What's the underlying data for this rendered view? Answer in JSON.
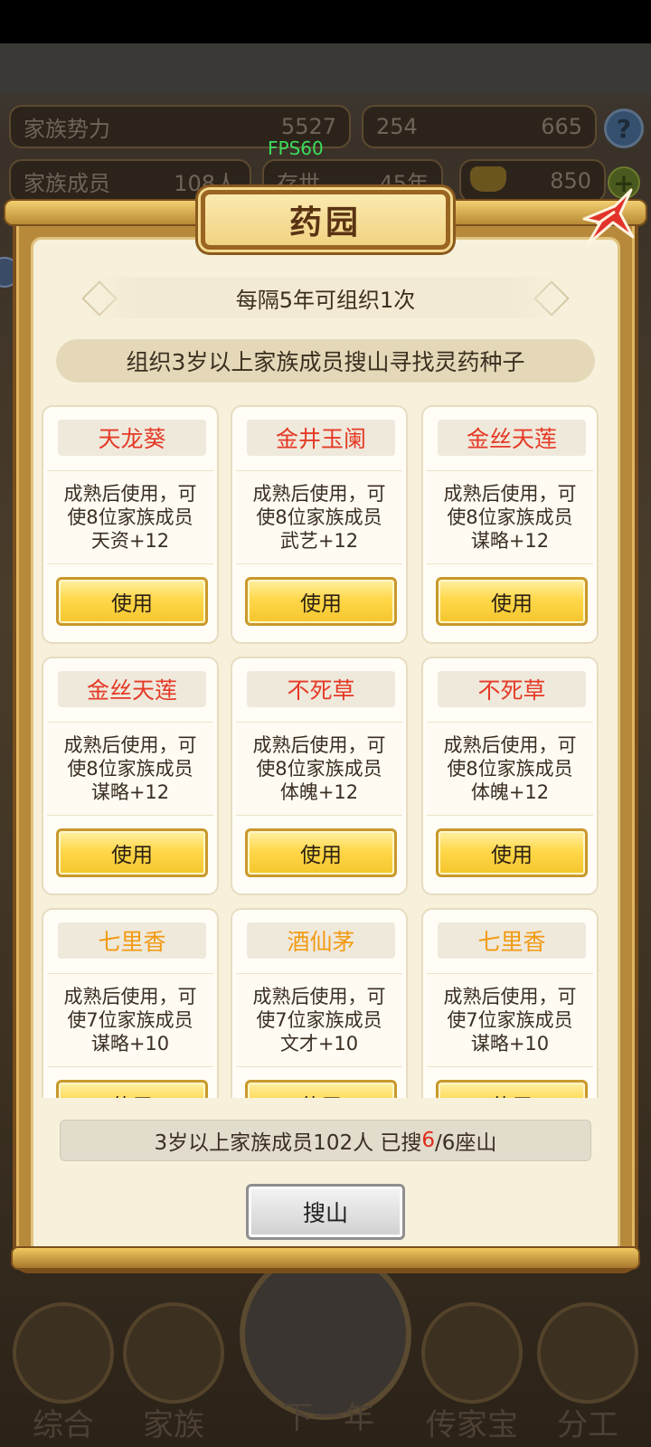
{
  "top_stats": {
    "power_label": "家族势力",
    "power_value": "5527",
    "members_label": "家族成员",
    "members_value": "108人",
    "alive_label": "存世",
    "alive_value": "45年",
    "res1_value": "254",
    "res2_value": "665",
    "gold_value": "850",
    "fps": "FPS60"
  },
  "dialog": {
    "title": "药园",
    "interval_text": "每隔5年可组织1次",
    "description": "组织3岁以上家族成员搜山寻找灵药种子",
    "cards": [
      {
        "name": "天龙葵",
        "line1": "成熟后使用，可",
        "line2": "使8位家族成员",
        "line3": "天资+12",
        "use_label": "使用",
        "name_color": "#e53a26"
      },
      {
        "name": "金井玉阑",
        "line1": "成熟后使用，可",
        "line2": "使8位家族成员",
        "line3": "武艺+12",
        "use_label": "使用",
        "name_color": "#e53a26"
      },
      {
        "name": "金丝天莲",
        "line1": "成熟后使用，可",
        "line2": "使8位家族成员",
        "line3": "谋略+12",
        "use_label": "使用",
        "name_color": "#e53a26"
      },
      {
        "name": "金丝天莲",
        "line1": "成熟后使用，可",
        "line2": "使8位家族成员",
        "line3": "谋略+12",
        "use_label": "使用",
        "name_color": "#e53a26"
      },
      {
        "name": "不死草",
        "line1": "成熟后使用，可",
        "line2": "使8位家族成员",
        "line3": "体魄+12",
        "use_label": "使用",
        "name_color": "#e53a26"
      },
      {
        "name": "不死草",
        "line1": "成熟后使用，可",
        "line2": "使8位家族成员",
        "line3": "体魄+12",
        "use_label": "使用",
        "name_color": "#e53a26"
      },
      {
        "name": "七里香",
        "line1": "成熟后使用，可",
        "line2": "使7位家族成员",
        "line3": "谋略+10",
        "use_label": "使用",
        "name_color": "#f29a12"
      },
      {
        "name": "酒仙茅",
        "line1": "成熟后使用，可",
        "line2": "使7位家族成员",
        "line3": "文才+10",
        "use_label": "使用",
        "name_color": "#f29a12"
      },
      {
        "name": "七里香",
        "line1": "成熟后使用，可",
        "line2": "使7位家族成员",
        "line3": "谋略+10",
        "use_label": "使用",
        "name_color": "#f29a12"
      }
    ],
    "summary_prefix": "3岁以上家族成员102人 已搜",
    "summary_searched": "6",
    "summary_suffix": "/6座山",
    "search_button": "搜山"
  },
  "bottom_nav": {
    "items": [
      "综合",
      "家族",
      "下一年",
      "传家宝",
      "分工"
    ]
  }
}
